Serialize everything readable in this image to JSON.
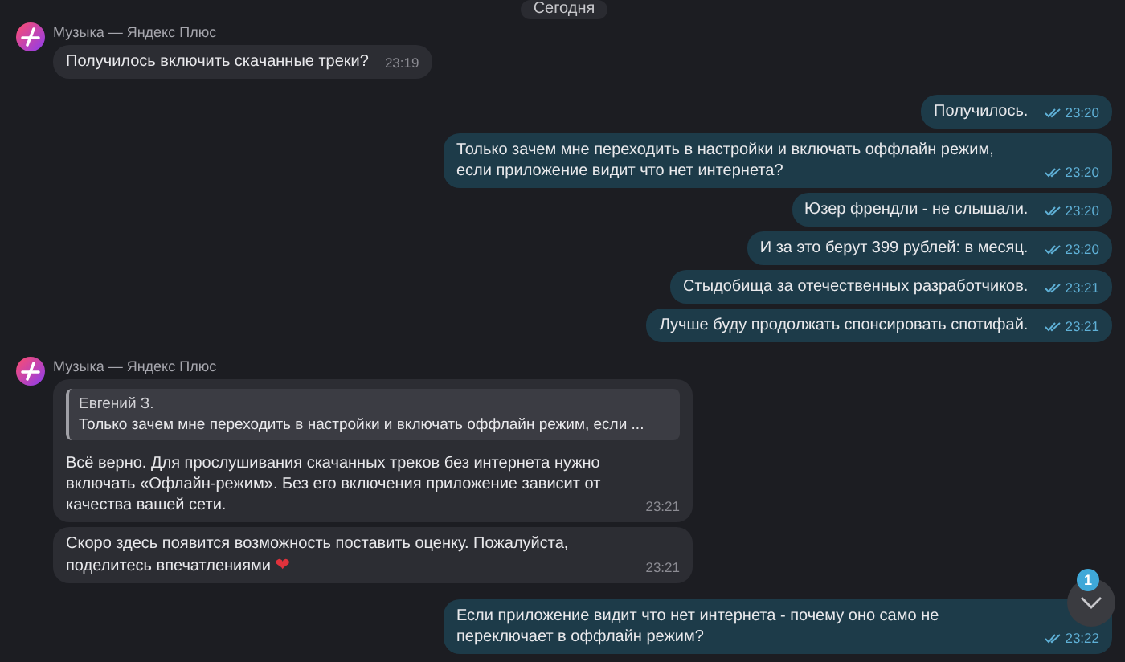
{
  "date_badge": "Сегодня",
  "messages": [
    {
      "kind": "incoming",
      "sender": "Музыка — Яндекс Плюс",
      "text": "Получилось включить скачанные треки?",
      "time": "23:19"
    },
    {
      "kind": "outgoing",
      "text": "Получилось.",
      "time": "23:20",
      "read": true
    },
    {
      "kind": "outgoing",
      "text": "Только зачем мне переходить в настройки и включать оффлайн режим, если приложение видит что нет интернета?",
      "time": "23:20",
      "read": true
    },
    {
      "kind": "outgoing",
      "text": "Юзер френдли - не слышали.",
      "time": "23:20",
      "read": true
    },
    {
      "kind": "outgoing",
      "text": "И за это берут 399 рублей: в месяц.",
      "time": "23:20",
      "read": true
    },
    {
      "kind": "outgoing",
      "text": "Стыдобища за отечественных разработчиков.",
      "time": "23:21",
      "read": true
    },
    {
      "kind": "outgoing",
      "text": "Лучше буду продолжать спонсировать спотифай.",
      "time": "23:21",
      "read": true
    },
    {
      "kind": "incoming",
      "sender": "Музыка — Яндекс Плюс",
      "quote": {
        "author": "Евгений З.",
        "text": "Только зачем мне переходить в настройки и включать оффлайн режим, если ..."
      },
      "text": "Всё верно. Для прослушивания скачанных треков без интернета нужно включать «Офлайн-режим». Без его включения приложение зависит от качества вашей сети.",
      "time": "23:21"
    },
    {
      "kind": "incoming",
      "text": "Скоро здесь появится возможность поставить оценку. Пожалуйста, поделитесь впечатлениями",
      "emoji": "❤",
      "time": "23:21"
    },
    {
      "kind": "outgoing",
      "text": "Если приложение видит что нет интернета - почему оно само не переключает в оффлайн режим?",
      "time": "23:22",
      "read": true
    }
  ],
  "scroll_button": {
    "unread_count": "1"
  }
}
